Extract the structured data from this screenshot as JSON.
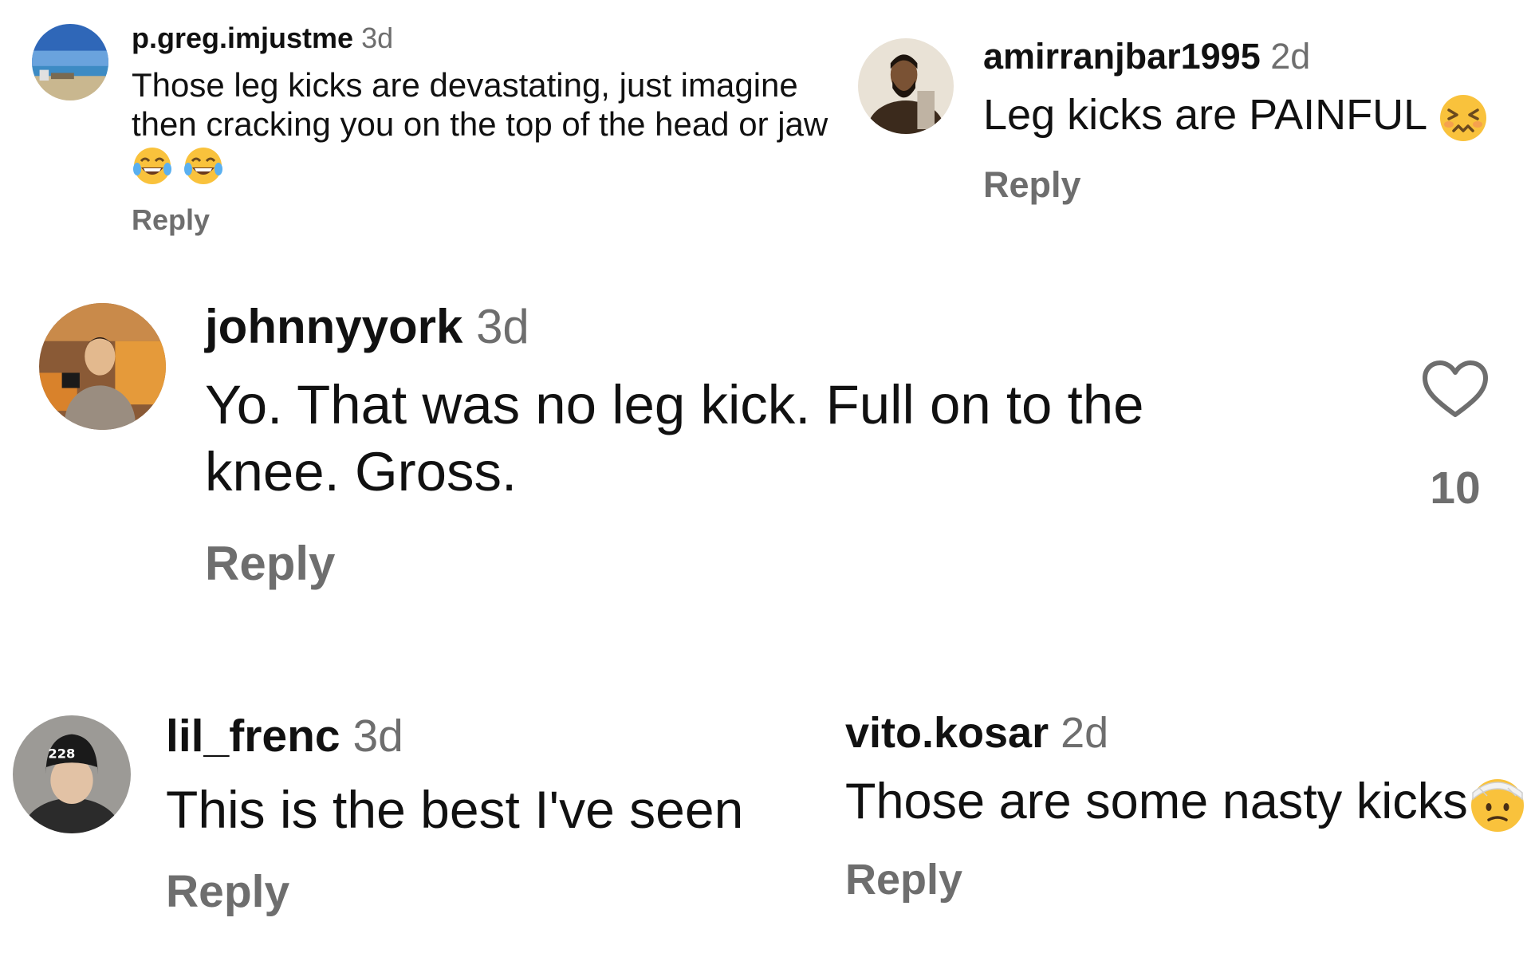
{
  "comments": [
    {
      "username": "p.greg.imjustme",
      "time": "3d",
      "text": "Those leg kicks are devastating, just imagine then cracking you on the top of the head or jaw",
      "emojis": [
        "tears-of-joy-emoji",
        "tears-of-joy-emoji"
      ],
      "reply_label": "Reply"
    },
    {
      "username": "amirranjbar1995",
      "time": "2d",
      "text": "Leg kicks are PAINFUL",
      "emojis": [
        "confounded-face-emoji"
      ],
      "reply_label": "Reply"
    },
    {
      "username": "johnnyyork",
      "time": "3d",
      "text": "Yo. That was no leg kick. Full on to the knee. Gross.",
      "reply_label": "Reply",
      "like_count": "10",
      "like_icon": "heart-outline-icon"
    },
    {
      "username": "lil_frenc",
      "time": "3d",
      "text": "This is the best I've seen",
      "reply_label": "Reply"
    },
    {
      "username": "vito.kosar",
      "time": "2d",
      "text": "Those are some nasty kicks",
      "emojis": [
        "face-with-head-bandage-emoji"
      ],
      "reply_label": "Reply"
    }
  ],
  "colors": {
    "background": "#ffffff",
    "text": "#111111",
    "secondary": "#6e6e6e",
    "emoji_yellow": "#f9c23c"
  }
}
